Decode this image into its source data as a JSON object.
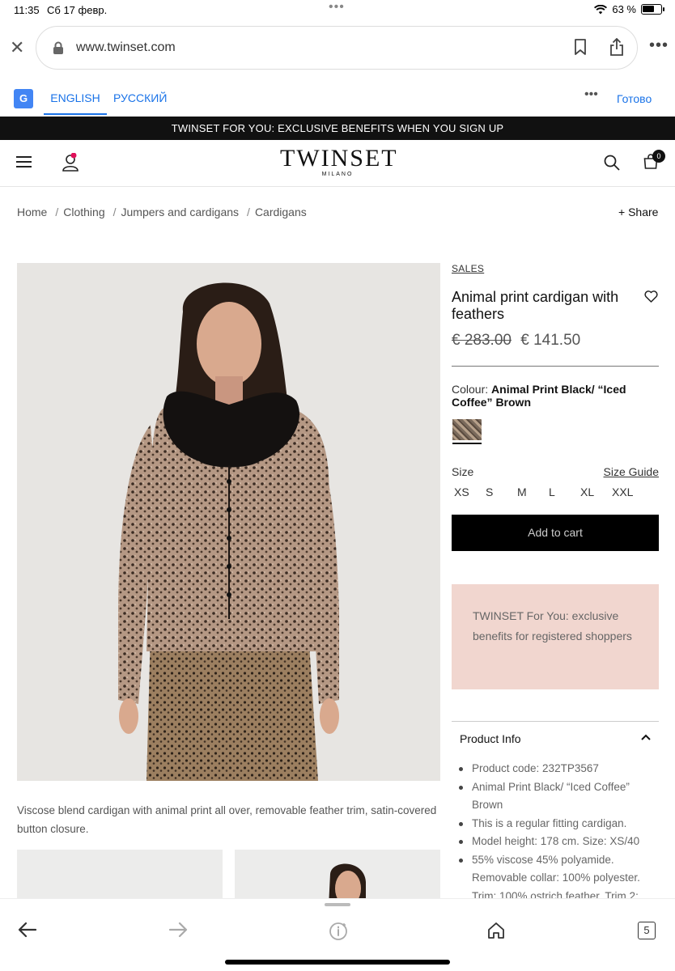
{
  "status": {
    "time": "11:35",
    "date": "Сб 17 февр.",
    "battery": "63 %"
  },
  "browser": {
    "url": "www.twinset.com"
  },
  "translate": {
    "lang_en": "ENGLISH",
    "lang_ru": "РУССКИЙ",
    "done": "Готово"
  },
  "promo": "TWINSET FOR YOU: EXCLUSIVE BENEFITS WHEN YOU SIGN UP",
  "logo": {
    "main": "TWINSET",
    "sub": "MILANO"
  },
  "cart_count": "0",
  "breadcrumb": [
    "Home",
    "Clothing",
    "Jumpers and cardigans",
    "Cardigans"
  ],
  "breadcrumb_sep": "/",
  "share": "+ Share",
  "product": {
    "badge": "SALES",
    "title": "Animal print cardigan with feathers",
    "old_price": "€ 283.00",
    "price": "€ 141.50",
    "colour_label": "Colour: ",
    "colour_value": "Animal Print Black/ “Iced Coffee” Brown",
    "size_label": "Size",
    "size_guide": "Size Guide",
    "sizes": [
      "XS",
      "S",
      "M",
      "L",
      "XL",
      "XXL"
    ],
    "add_to_cart": "Add to cart",
    "benefits": "TWINSET For You: exclusive benefits for registered shoppers",
    "info_title": "Product Info",
    "info_items": [
      "Product code: 232TP3567",
      "Animal Print Black/ “Iced Coffee” Brown",
      "This is a regular fitting cardigan.",
      "Model height: 178 cm. Size: XS/40",
      "55% viscose 45% polyamide. Removable collar: 100% polyester. Trim: 100% ostrich feather. Trim 2:"
    ],
    "description": "Viscose blend cardigan with animal print all over, removable feather trim, satin-covered button closure."
  },
  "bottom": {
    "tabs_count": "5"
  }
}
